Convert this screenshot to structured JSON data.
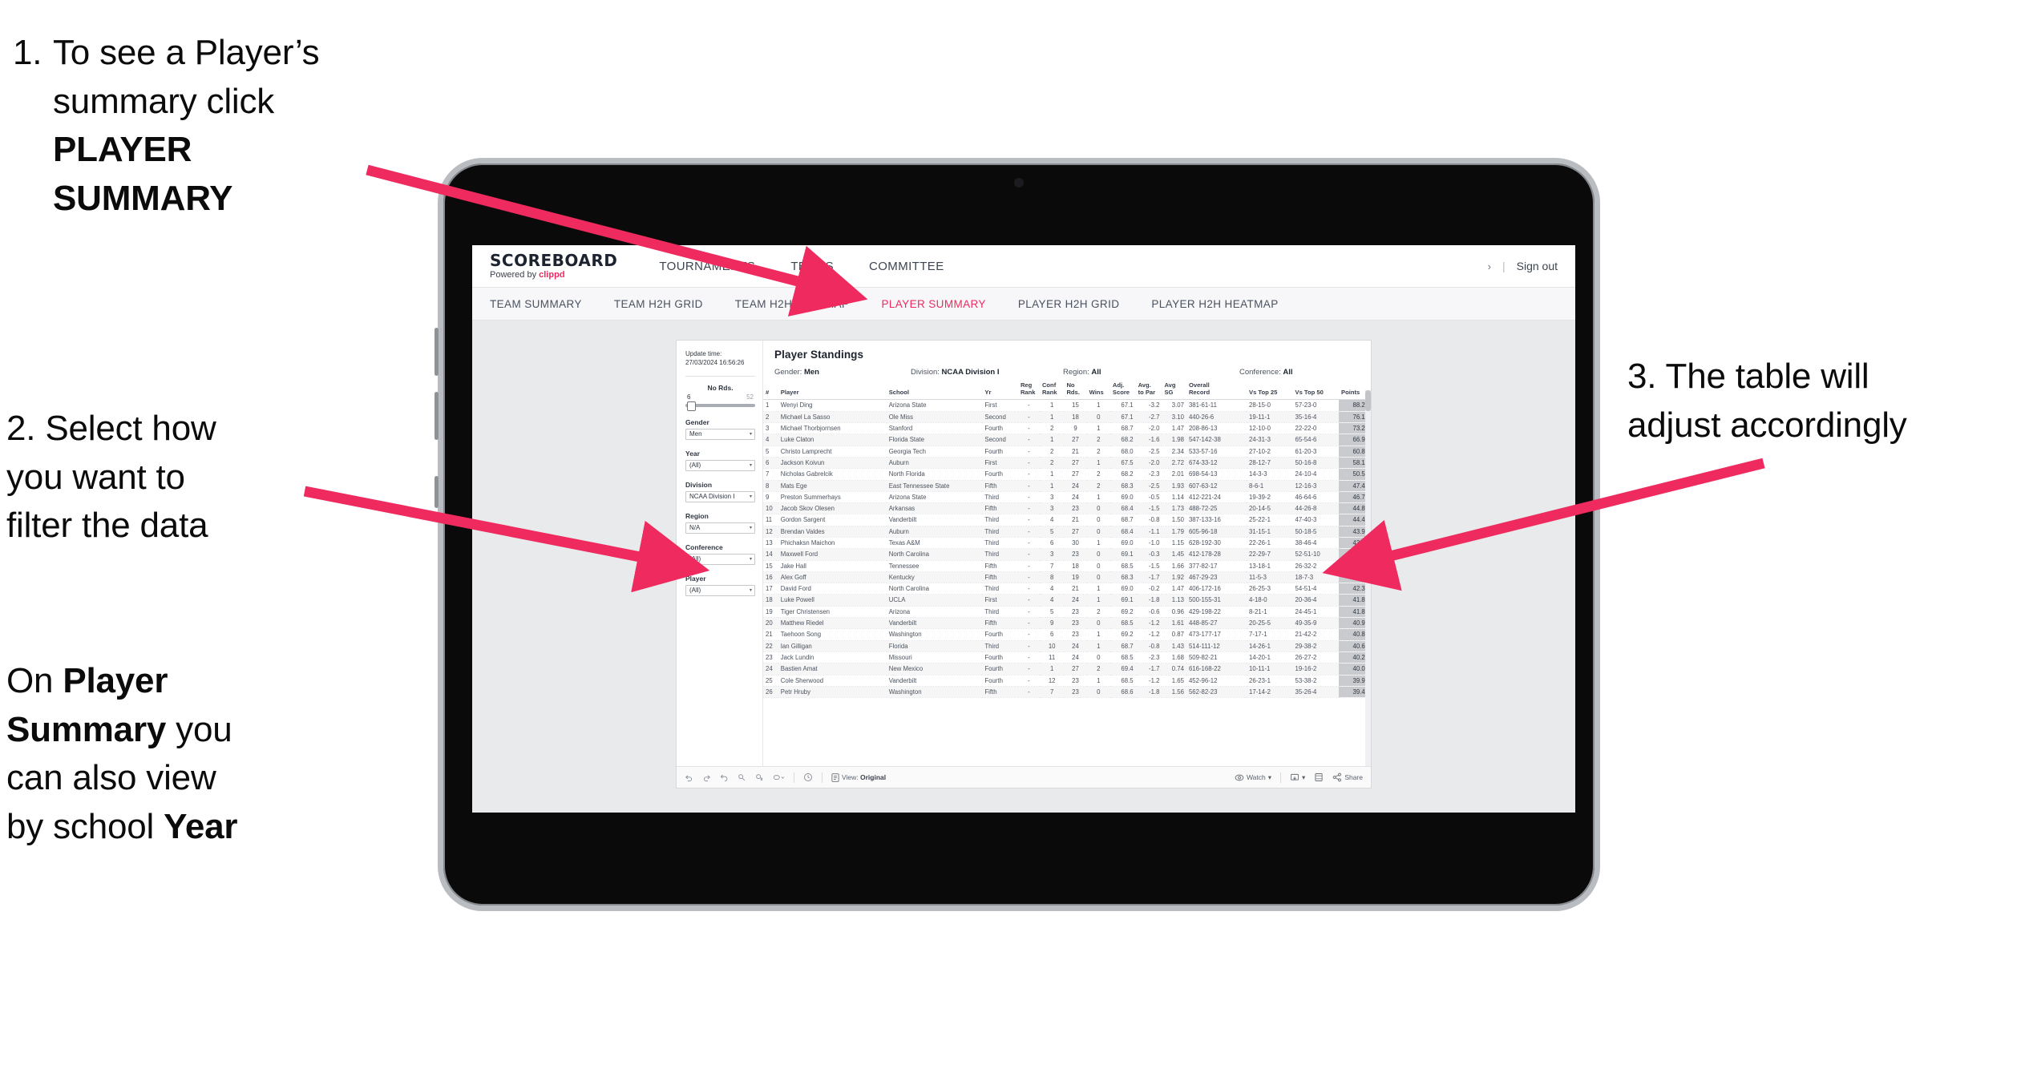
{
  "annotations": {
    "step1": {
      "number": "1.",
      "line1": "To see a Player’s",
      "line2_pre": "summary click ",
      "line2_bold": "PLAYER",
      "line3_bold": "SUMMARY"
    },
    "step2": {
      "line1": "2. Select how",
      "line2": "you want to",
      "line3": "filter the data"
    },
    "step2b": {
      "pre1": "On ",
      "b1": "Player",
      "b2": "Summary",
      "mid": " you",
      "line3": "can also view",
      "line4_pre": "by school ",
      "line4_bold": "Year"
    },
    "step3": {
      "line1": "3. The table will",
      "line2": "adjust accordingly"
    }
  },
  "colors": {
    "accent": "#ee2a5f",
    "bezel": "#b9bcc0",
    "canvas": "#e9eaec",
    "points_cell": "#c9cbcf"
  },
  "app": {
    "logo": {
      "word": "SCOREBOARD",
      "powered_pre": "Powered by ",
      "brand": "clippd"
    },
    "topnav": [
      "TOURNAMENTS",
      "TEAMS",
      "COMMITTEE"
    ],
    "account": {
      "chevron": "›",
      "separator": "|",
      "sign_out": "Sign out"
    },
    "subnav": {
      "items": [
        "TEAM SUMMARY",
        "TEAM H2H GRID",
        "TEAM H2H HEATMAP",
        "PLAYER SUMMARY",
        "PLAYER H2H GRID",
        "PLAYER H2H HEATMAP"
      ],
      "active": "PLAYER SUMMARY"
    }
  },
  "filters": {
    "update_label": "Update time:",
    "update_value": "27/03/2024 16:56:26",
    "slider": {
      "label": "No Rds.",
      "min": "6",
      "max": "52",
      "value": "6"
    },
    "groups": [
      {
        "label": "Gender",
        "value": "Men"
      },
      {
        "label": "Year",
        "value": "(All)"
      },
      {
        "label": "Division",
        "value": "NCAA Division I"
      },
      {
        "label": "Region",
        "value": "N/A"
      },
      {
        "label": "Conference",
        "value": "(All)"
      },
      {
        "label": "Player",
        "value": "(All)"
      }
    ],
    "caret": "▾"
  },
  "viz": {
    "title": "Player Standings",
    "facets": [
      {
        "label": "Gender: ",
        "value": "Men"
      },
      {
        "label": "Division: ",
        "value": "NCAA Division I"
      },
      {
        "label": "Region: ",
        "value": "All"
      },
      {
        "label": "Conference: ",
        "value": "All"
      }
    ],
    "columns": [
      "#",
      "Player",
      "School",
      "Yr",
      "Reg Rank",
      "Conf Rank",
      "No Rds.",
      "Wins",
      "Adj. Score",
      "Avg. to Par",
      "Avg SG",
      "Overall Record",
      "Vs Top 25",
      "Vs Top 50",
      "Points"
    ],
    "columns_split": [
      [
        "#",
        ""
      ],
      [
        "Player",
        ""
      ],
      [
        "School",
        ""
      ],
      [
        "Yr",
        ""
      ],
      [
        "Reg",
        "Rank"
      ],
      [
        "Conf",
        "Rank"
      ],
      [
        "No",
        "Rds."
      ],
      [
        "Wins",
        ""
      ],
      [
        "Adj.",
        "Score"
      ],
      [
        "Avg.",
        "to Par"
      ],
      [
        "Avg",
        "SG"
      ],
      [
        "Overall",
        "Record"
      ],
      [
        "Vs Top 25",
        ""
      ],
      [
        "Vs Top 50",
        ""
      ],
      [
        "Points",
        ""
      ]
    ],
    "rows": [
      [
        "1",
        "Wenyi Ding",
        "Arizona State",
        "First",
        "-",
        "1",
        "15",
        "1",
        "67.1",
        "-3.2",
        "3.07",
        "381-61-11",
        "28-15-0",
        "57-23-0",
        "88.22"
      ],
      [
        "2",
        "Michael La Sasso",
        "Ole Miss",
        "Second",
        "-",
        "1",
        "18",
        "0",
        "67.1",
        "-2.7",
        "3.10",
        "440-26-6",
        "19-11-1",
        "35-16-4",
        "76.12"
      ],
      [
        "3",
        "Michael Thorbjornsen",
        "Stanford",
        "Fourth",
        "-",
        "2",
        "9",
        "1",
        "68.7",
        "-2.0",
        "1.47",
        "208-86-13",
        "12-10-0",
        "22-22-0",
        "73.22"
      ],
      [
        "4",
        "Luke Claton",
        "Florida State",
        "Second",
        "-",
        "1",
        "27",
        "2",
        "68.2",
        "-1.6",
        "1.98",
        "547-142-38",
        "24-31-3",
        "65-54-6",
        "66.94"
      ],
      [
        "5",
        "Christo Lamprecht",
        "Georgia Tech",
        "Fourth",
        "-",
        "2",
        "21",
        "2",
        "68.0",
        "-2.5",
        "2.34",
        "533-57-16",
        "27-10-2",
        "61-20-3",
        "60.89"
      ],
      [
        "6",
        "Jackson Koivun",
        "Auburn",
        "First",
        "-",
        "2",
        "27",
        "1",
        "67.5",
        "-2.0",
        "2.72",
        "674-33-12",
        "28-12-7",
        "50-16-8",
        "58.18"
      ],
      [
        "7",
        "Nicholas Gabrelcik",
        "North Florida",
        "Fourth",
        "-",
        "1",
        "27",
        "2",
        "68.2",
        "-2.3",
        "2.01",
        "698-54-13",
        "14-3-3",
        "24-10-4",
        "50.56"
      ],
      [
        "8",
        "Mats Ege",
        "East Tennessee State",
        "Fifth",
        "-",
        "1",
        "24",
        "2",
        "68.3",
        "-2.5",
        "1.93",
        "607-63-12",
        "8-6-1",
        "12-16-3",
        "47.42"
      ],
      [
        "9",
        "Preston Summerhays",
        "Arizona State",
        "Third",
        "-",
        "3",
        "24",
        "1",
        "69.0",
        "-0.5",
        "1.14",
        "412-221-24",
        "19-39-2",
        "46-64-6",
        "46.77"
      ],
      [
        "10",
        "Jacob Skov Olesen",
        "Arkansas",
        "Fifth",
        "-",
        "3",
        "23",
        "0",
        "68.4",
        "-1.5",
        "1.73",
        "488-72-25",
        "20-14-5",
        "44-26-8",
        "44.82"
      ],
      [
        "11",
        "Gordon Sargent",
        "Vanderbilt",
        "Third",
        "-",
        "4",
        "21",
        "0",
        "68.7",
        "-0.8",
        "1.50",
        "387-133-16",
        "25-22-1",
        "47-40-3",
        "44.49"
      ],
      [
        "12",
        "Brendan Valdes",
        "Auburn",
        "Third",
        "-",
        "5",
        "27",
        "0",
        "68.4",
        "-1.1",
        "1.79",
        "605-96-18",
        "31-15-1",
        "50-18-5",
        "43.95"
      ],
      [
        "13",
        "Phichaksn Maichon",
        "Texas A&M",
        "Third",
        "-",
        "6",
        "30",
        "1",
        "69.0",
        "-1.0",
        "1.15",
        "628-192-30",
        "22-26-1",
        "38-46-4",
        "43.83"
      ],
      [
        "14",
        "Maxwell Ford",
        "North Carolina",
        "Third",
        "-",
        "3",
        "23",
        "0",
        "69.1",
        "-0.3",
        "1.45",
        "412-178-28",
        "22-29-7",
        "52-51-10",
        "42.75"
      ],
      [
        "15",
        "Jake Hall",
        "Tennessee",
        "Fifth",
        "-",
        "7",
        "18",
        "0",
        "68.5",
        "-1.5",
        "1.66",
        "377-82-17",
        "13-18-1",
        "26-32-2",
        "42.55"
      ],
      [
        "16",
        "Alex Goff",
        "Kentucky",
        "Fifth",
        "-",
        "8",
        "19",
        "0",
        "68.3",
        "-1.7",
        "1.92",
        "467-29-23",
        "11-5-3",
        "18-7-3",
        "42.54"
      ],
      [
        "17",
        "David Ford",
        "North Carolina",
        "Third",
        "-",
        "4",
        "21",
        "1",
        "69.0",
        "-0.2",
        "1.47",
        "406-172-16",
        "26-25-3",
        "54-51-4",
        "42.35"
      ],
      [
        "18",
        "Luke Powell",
        "UCLA",
        "First",
        "-",
        "4",
        "24",
        "1",
        "69.1",
        "-1.8",
        "1.13",
        "500-155-31",
        "4-18-0",
        "20-36-4",
        "41.87"
      ],
      [
        "19",
        "Tiger Christensen",
        "Arizona",
        "Third",
        "-",
        "5",
        "23",
        "2",
        "69.2",
        "-0.6",
        "0.96",
        "429-198-22",
        "8-21-1",
        "24-45-1",
        "41.81"
      ],
      [
        "20",
        "Matthew Riedel",
        "Vanderbilt",
        "Fifth",
        "-",
        "9",
        "23",
        "0",
        "68.5",
        "-1.2",
        "1.61",
        "448-85-27",
        "20-25-5",
        "49-35-9",
        "40.98"
      ],
      [
        "21",
        "Taehoon Song",
        "Washington",
        "Fourth",
        "-",
        "6",
        "23",
        "1",
        "69.2",
        "-1.2",
        "0.87",
        "473-177-17",
        "7-17-1",
        "21-42-2",
        "40.88"
      ],
      [
        "22",
        "Ian Gilligan",
        "Florida",
        "Third",
        "-",
        "10",
        "24",
        "1",
        "68.7",
        "-0.8",
        "1.43",
        "514-111-12",
        "14-26-1",
        "29-38-2",
        "40.68"
      ],
      [
        "23",
        "Jack Lundin",
        "Missouri",
        "Fourth",
        "-",
        "11",
        "24",
        "0",
        "68.5",
        "-2.3",
        "1.68",
        "509-82-21",
        "14-20-1",
        "26-27-2",
        "40.27"
      ],
      [
        "24",
        "Bastien Amat",
        "New Mexico",
        "Fourth",
        "-",
        "1",
        "27",
        "2",
        "69.4",
        "-1.7",
        "0.74",
        "616-168-22",
        "10-11-1",
        "19-16-2",
        "40.02"
      ],
      [
        "25",
        "Cole Sherwood",
        "Vanderbilt",
        "Fourth",
        "-",
        "12",
        "23",
        "1",
        "68.5",
        "-1.2",
        "1.65",
        "452-96-12",
        "26-23-1",
        "53-38-2",
        "39.95"
      ],
      [
        "26",
        "Petr Hruby",
        "Washington",
        "Fifth",
        "-",
        "7",
        "23",
        "0",
        "68.6",
        "-1.8",
        "1.56",
        "562-82-23",
        "17-14-2",
        "35-26-4",
        "39.49"
      ]
    ]
  },
  "toolbar": {
    "view_label": "View: ",
    "view_value": "Original",
    "watch": "Watch",
    "share": "Share",
    "caret": "▾"
  }
}
